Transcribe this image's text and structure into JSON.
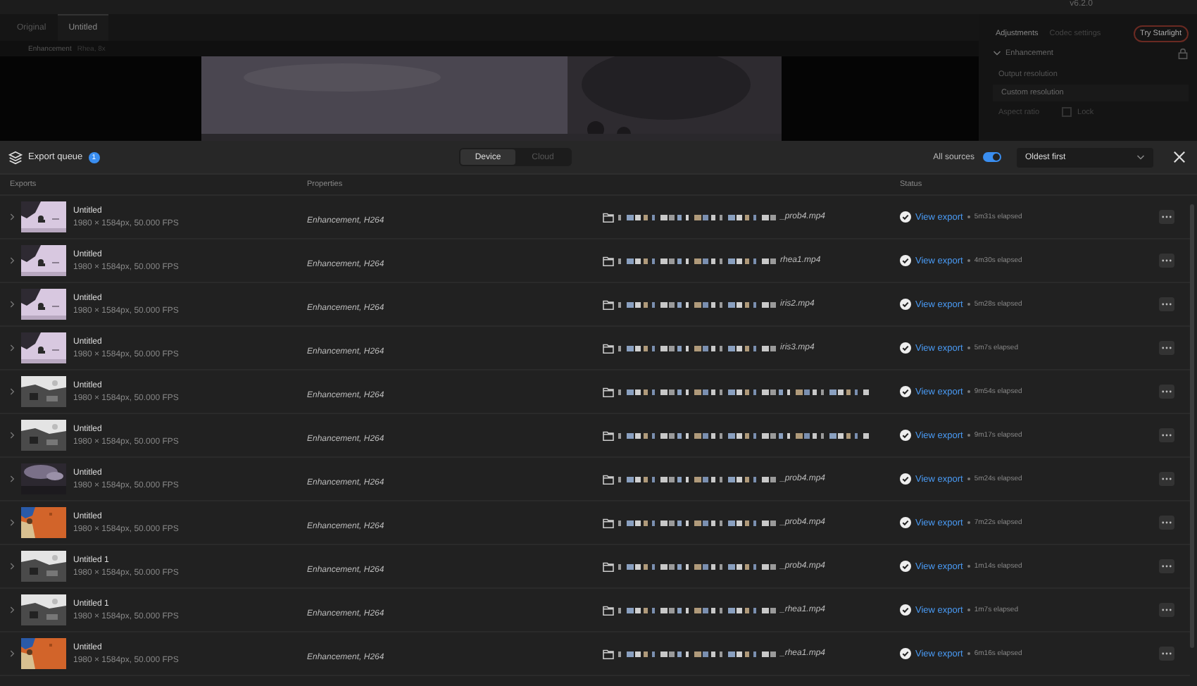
{
  "app": {
    "version": "v6.2.0",
    "tabs": [
      {
        "label": "Original",
        "selected": false
      },
      {
        "label": "Untitled",
        "selected": true
      }
    ],
    "toolbar": {
      "label": "Enhancement",
      "detail": "Rhea, 8x"
    },
    "side_tabs": [
      {
        "label": "Adjustments",
        "selected": true
      },
      {
        "label": "Codec settings",
        "selected": false
      }
    ],
    "try_button": "Try Starlight",
    "section": {
      "title": "Enhancement",
      "expanded": true
    },
    "output_resolution": {
      "label": "Output resolution",
      "value": "Custom resolution"
    },
    "aspect": {
      "label": "Aspect ratio",
      "lock_label": "Lock",
      "checked": false
    }
  },
  "export_queue": {
    "title": "Export queue",
    "count": "1",
    "modes": [
      {
        "label": "Device",
        "selected": true
      },
      {
        "label": "Cloud",
        "selected": false
      }
    ],
    "all_sources": {
      "label": "All sources",
      "on": true
    },
    "sort": "Oldest first",
    "columns": [
      "Exports",
      "Properties",
      "Status"
    ],
    "rows": [
      {
        "title": "Untitled",
        "specs": "1980 × 1584px, 50.000 FPS",
        "properties": "Enhancement, H264",
        "path_end": "_prob4.mp4",
        "action": "View export",
        "elapsed": "5m31s elapsed"
      },
      {
        "title": "Untitled",
        "specs": "1980 × 1584px, 50.000 FPS",
        "properties": "Enhancement, H264",
        "path_end": "rhea1.mp4",
        "action": "View export",
        "elapsed": "4m30s elapsed"
      },
      {
        "title": "Untitled",
        "specs": "1980 × 1584px, 50.000 FPS",
        "properties": "Enhancement, H264",
        "path_end": "iris2.mp4",
        "action": "View export",
        "elapsed": "5m28s elapsed"
      },
      {
        "title": "Untitled",
        "specs": "1980 × 1584px, 50.000 FPS",
        "properties": "Enhancement, H264",
        "path_end": "iris3.mp4",
        "action": "View export",
        "elapsed": "5m7s elapsed"
      },
      {
        "title": "Untitled",
        "specs": "1980 × 1584px, 50.000 FPS",
        "properties": "Enhancement, H264",
        "action": "View export",
        "elapsed": "9m54s elapsed"
      },
      {
        "title": "Untitled",
        "specs": "1980 × 1584px, 50.000 FPS",
        "properties": "Enhancement, H264",
        "action": "View export",
        "elapsed": "9m17s elapsed"
      },
      {
        "title": "Untitled",
        "specs": "1980 × 1584px, 50.000 FPS",
        "properties": "Enhancement, H264",
        "path_end": "_prob4.mp4",
        "action": "View export",
        "elapsed": "5m24s elapsed"
      },
      {
        "title": "Untitled",
        "specs": "1980 × 1584px, 50.000 FPS",
        "properties": "Enhancement, H264",
        "path_end": "_prob4.mp4",
        "action": "View export",
        "elapsed": "7m22s elapsed"
      },
      {
        "title": "Untitled 1",
        "specs": "1980 × 1584px, 50.000 FPS",
        "properties": "Enhancement, H264",
        "path_end": "_prob4.mp4",
        "action": "View export",
        "elapsed": "1m14s elapsed"
      },
      {
        "title": "Untitled 1",
        "specs": "1980 × 1584px, 50.000 FPS",
        "properties": "Enhancement, H264",
        "path_end": "_rhea1.mp4",
        "action": "View export",
        "elapsed": "1m7s elapsed"
      },
      {
        "title": "Untitled",
        "specs": "1980 × 1584px, 50.000 FPS",
        "properties": "Enhancement, H264",
        "path_end": "_rhea1.mp4",
        "action": "View export",
        "elapsed": "6m16s elapsed"
      }
    ]
  }
}
